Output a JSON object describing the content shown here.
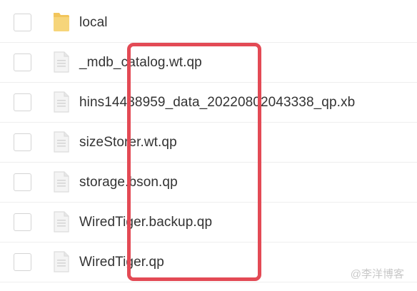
{
  "files": [
    {
      "name": "local",
      "type": "folder",
      "icon": "folder-icon"
    },
    {
      "name": "_mdb_catalog.wt.qp",
      "type": "file",
      "icon": "file-icon"
    },
    {
      "name": "hins14438959_data_20220802043338_qp.xb",
      "type": "file",
      "icon": "file-icon"
    },
    {
      "name": "sizeStorer.wt.qp",
      "type": "file",
      "icon": "file-icon"
    },
    {
      "name": "storage.bson.qp",
      "type": "file",
      "icon": "file-icon"
    },
    {
      "name": "WiredTiger.backup.qp",
      "type": "file",
      "icon": "file-icon"
    },
    {
      "name": "WiredTiger.qp",
      "type": "file",
      "icon": "file-icon"
    }
  ],
  "watermark": "@李洋博客",
  "colors": {
    "highlight": "#e34a55",
    "folder": "#f2c55c",
    "file_icon": "#dcdcdc"
  }
}
